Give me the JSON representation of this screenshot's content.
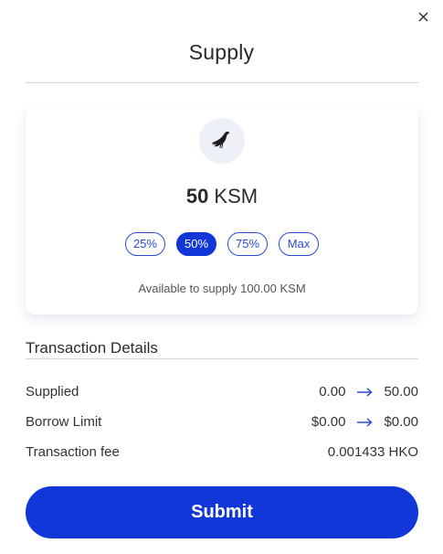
{
  "modal": {
    "title": "Supply",
    "close_icon": "close-icon"
  },
  "card": {
    "token_icon": "kusama-bird-icon",
    "amount": "50",
    "symbol": "KSM",
    "percent_options": [
      {
        "label": "25%",
        "active": false
      },
      {
        "label": "50%",
        "active": true
      },
      {
        "label": "75%",
        "active": false
      },
      {
        "label": "Max",
        "active": false
      }
    ],
    "available_text": "Available to supply 100.00 KSM"
  },
  "details": {
    "title": "Transaction Details",
    "rows": [
      {
        "label": "Supplied",
        "from": "0.00",
        "to": "50.00"
      },
      {
        "label": "Borrow Limit",
        "from": "$0.00",
        "to": "$0.00"
      },
      {
        "label": "Transaction fee",
        "value": "0.001433 HKO"
      }
    ]
  },
  "submit_label": "Submit",
  "colors": {
    "accent": "#1137d9",
    "divider": "#d4d4d4",
    "icon_bg": "#eef0f7"
  }
}
